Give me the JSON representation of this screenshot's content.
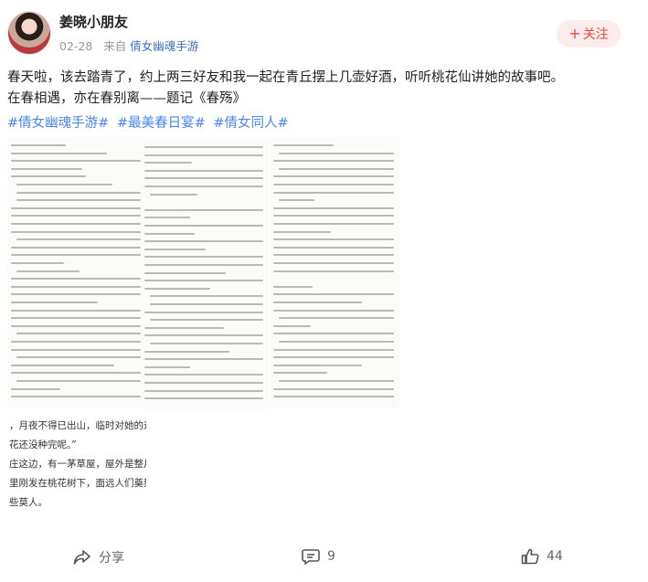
{
  "post": {
    "user": {
      "name": "姜晓小朋友"
    },
    "date": "02-28",
    "source_prefix": "来自",
    "source_name": "倩女幽魂手游",
    "follow_label": "关注",
    "text_line1": "春天啦，该去踏青了，约上两三好友和我一起在青丘摆上几壶好酒，听听桃花仙讲她的故事吧。",
    "text_line2": "在春相遇，亦在春别离——题记《春殇》",
    "topics": [
      "#倩女幽魂手游#",
      "#最美春日宴#",
      "#倩女同人#"
    ],
    "image_snippet_lines": [
      "，月夜不得已出山，临时对她的退缩说到：“等",
      "花还没种完呢。”",
      "庄这边，有一茅草屋，屋外是整片桃林，有一丝",
      "里刚发在桃花树下，面远人们奠劾为桃花仙，！",
      "些莫人。"
    ]
  },
  "actions": {
    "share_label": "分享",
    "comment_count": "9",
    "like_count": "44"
  },
  "colors": {
    "follow_bg": "#fdecec",
    "follow_text": "#e8483d",
    "link": "#4a86e8",
    "meta": "#999999"
  }
}
